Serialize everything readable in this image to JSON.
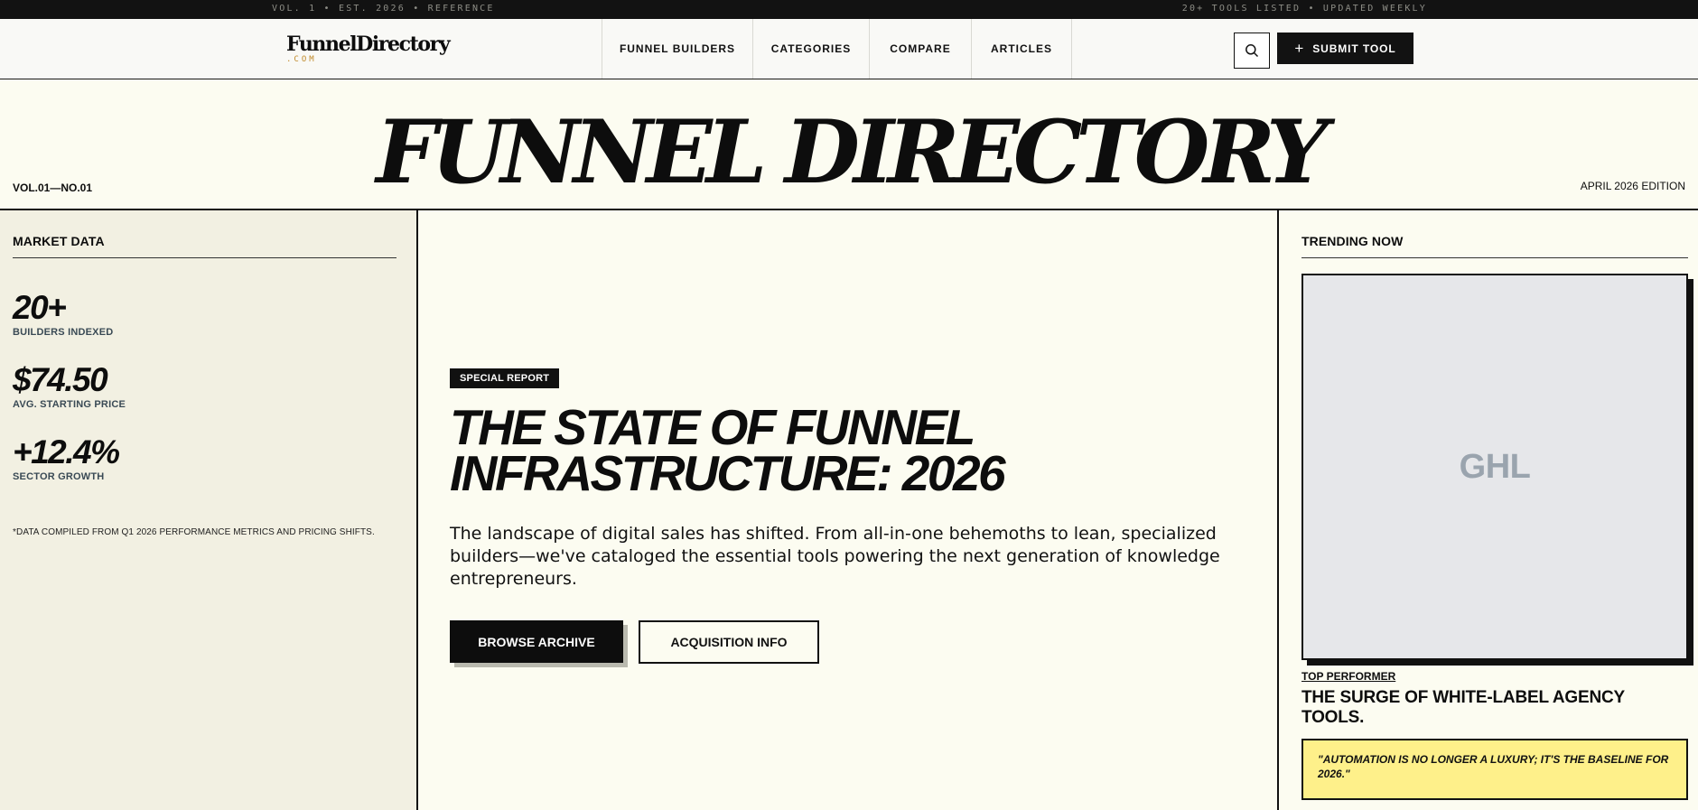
{
  "topstrip": {
    "left": "VOL. 1 • EST. 2026 • REFERENCE",
    "right": "20+ TOOLS LISTED • UPDATED WEEKLY"
  },
  "nav": {
    "logo": "FunnelDirectory",
    "logo_sub": ".COM",
    "items": [
      {
        "label": "FUNNEL BUILDERS"
      },
      {
        "label": "CATEGORIES"
      },
      {
        "label": "COMPARE"
      },
      {
        "label": "ARTICLES"
      }
    ],
    "search_icon": "search-icon",
    "submit_label": "SUBMIT TOOL",
    "submit_icon": "plus-icon"
  },
  "masthead": {
    "title": "FUNNEL DIRECTORY",
    "volume": "VOL.01—NO.01",
    "edition": "APRIL 2026 EDITION"
  },
  "market": {
    "heading": "MARKET DATA",
    "stats": [
      {
        "value": "20+",
        "label": "BUILDERS INDEXED"
      },
      {
        "value": "$74.50",
        "label": "AVG. STARTING PRICE"
      },
      {
        "value": "+12.4%",
        "label": "SECTOR GROWTH"
      }
    ],
    "footnote": "*DATA COMPILED FROM Q1 2026 PERFORMANCE METRICS AND PRICING SHIFTS."
  },
  "feature": {
    "badge": "SPECIAL REPORT",
    "headline_line1": "THE STATE OF FUNNEL",
    "headline_line2": "INFRASTRUCTURE: 2026",
    "lede": "The landscape of digital sales has shifted. From all-in-one behemoths to lean, specialized builders—we've cataloged the essential tools powering the next generation of knowledge entrepreneurs.",
    "primary_cta": "BROWSE ARCHIVE",
    "secondary_cta": "ACQUISITION INFO"
  },
  "trending": {
    "heading": "TRENDING NOW",
    "image_label": "GHL",
    "tag": "TOP PERFORMER",
    "title": "THE SURGE OF WHITE-LABEL AGENCY TOOLS.",
    "quote": "\"AUTOMATION IS NO LONGER A LUXURY; IT'S THE BASELINE FOR 2026.\""
  },
  "colors": {
    "ink": "#0d0d0d",
    "paper": "#fcfcf1",
    "sidebar": "#f2f0e2",
    "accent_gold": "#c08a2b",
    "quote_yellow": "#fef08a"
  }
}
